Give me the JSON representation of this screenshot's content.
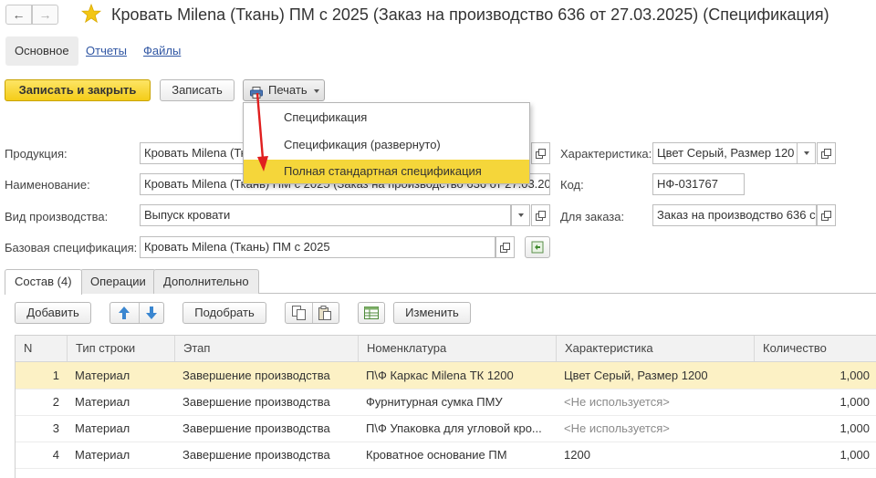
{
  "window": {
    "title": "Кровать Milena (Ткань) ПМ с 2025 (Заказ на производство 636 от 27.03.2025) (Спецификация)"
  },
  "section_tabs": [
    "Основное",
    "Отчеты",
    "Файлы"
  ],
  "toolbar": {
    "save_close": "Записать и закрыть",
    "save": "Записать",
    "print": "Печать"
  },
  "print_menu": {
    "items": [
      "Спецификация",
      "Спецификация (развернуто)",
      "Полная стандартная спецификация"
    ],
    "highlighted_index": 2
  },
  "form": {
    "product_label": "Продукция:",
    "product_value": "Кровать Milena (Ткань) ПМ с 2025",
    "name_label": "Наименование:",
    "name_value": "Кровать Milena (Ткань) ПМ с 2025 (Заказ на производство 636 от 27.03.20",
    "kind_label": "Вид производства:",
    "kind_value": "Выпуск кровати",
    "base_label": "Базовая спецификация:",
    "base_value": "Кровать Milena (Ткань) ПМ с 2025",
    "char_label": "Характеристика:",
    "char_value": "Цвет Серый, Размер 120",
    "code_label": "Код:",
    "code_value": "НФ-031767",
    "order_label": "Для заказа:",
    "order_value": "Заказ на производство 636 с"
  },
  "tabs": [
    "Состав (4)",
    "Операции",
    "Дополнительно"
  ],
  "table_toolbar": {
    "add": "Добавить",
    "select": "Подобрать",
    "change": "Изменить"
  },
  "table": {
    "columns": [
      "N",
      "Тип строки",
      "Этап",
      "Номенклатура",
      "Характеристика",
      "Количество"
    ],
    "rows": [
      {
        "n": "1",
        "type": "Материал",
        "stage": "Завершение производства",
        "item": "П\\Ф Каркас Milena ТК 1200",
        "char": "Цвет Серый, Размер 1200",
        "qty": "1,000"
      },
      {
        "n": "2",
        "type": "Материал",
        "stage": "Завершение производства",
        "item": "Фурнитурная сумка  ПМУ",
        "char": "<Не используется>",
        "qty": "1,000"
      },
      {
        "n": "3",
        "type": "Материал",
        "stage": "Завершение производства",
        "item": "П\\Ф Упаковка для угловой кро...",
        "char": "<Не используется>",
        "qty": "1,000"
      },
      {
        "n": "4",
        "type": "Материал",
        "stage": "Завершение производства",
        "item": "Кроватное основание ПМ",
        "char": "1200",
        "qty": "1,000"
      }
    ]
  },
  "colors": {
    "accent_yellow": "#f5d63a",
    "selected_row": "#fcf1c5",
    "link_blue": "#3056a3",
    "arrow_red": "#e01f1f"
  }
}
